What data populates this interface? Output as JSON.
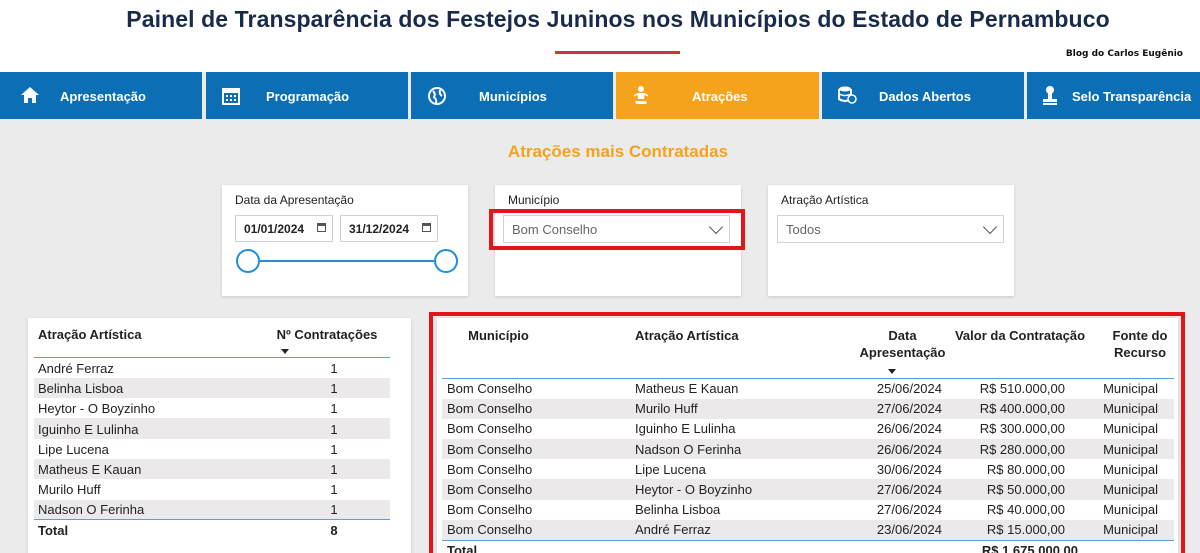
{
  "header": {
    "title": "Painel de Transparência dos Festejos Juninos nos Municípios do Estado de Pernambuco",
    "credit": "Blog do Carlos Eugênio"
  },
  "nav": {
    "tabs": [
      {
        "label": "Apresentação",
        "icon": "home-icon"
      },
      {
        "label": "Programação",
        "icon": "calendar-icon"
      },
      {
        "label": "Municípios",
        "icon": "globe-icon"
      },
      {
        "label": "Atrações",
        "icon": "performer-icon",
        "active": true
      },
      {
        "label": "Dados Abertos",
        "icon": "database-icon"
      },
      {
        "label": "Selo Transparência",
        "icon": "stamp-icon"
      }
    ]
  },
  "section_title": "Atrações mais Contratadas",
  "filters": {
    "date": {
      "label": "Data da Apresentação",
      "start": "01/01/2024",
      "end": "31/12/2024"
    },
    "municipio": {
      "label": "Município",
      "value": "Bom Conselho"
    },
    "atracao": {
      "label": "Atração Artística",
      "value": "Todos"
    }
  },
  "left_table": {
    "headers": [
      "Atração Artística",
      "Nº Contratações"
    ],
    "rows": [
      [
        "André Ferraz",
        "1"
      ],
      [
        "Belinha Lisboa",
        "1"
      ],
      [
        "Heytor - O Boyzinho",
        "1"
      ],
      [
        "Iguinho E Lulinha",
        "1"
      ],
      [
        "Lipe Lucena",
        "1"
      ],
      [
        "Matheus E Kauan",
        "1"
      ],
      [
        "Murilo Huff",
        "1"
      ],
      [
        "Nadson O Ferinha",
        "1"
      ]
    ],
    "total_label": "Total",
    "total_value": "8"
  },
  "right_table": {
    "headers": [
      "Município",
      "Atração Artística",
      "Data Apresentação",
      "Valor da Contratação",
      "Fonte do Recurso"
    ],
    "rows": [
      [
        "Bom Conselho",
        "Matheus E Kauan",
        "25/06/2024",
        "R$ 510.000,00",
        "Municipal"
      ],
      [
        "Bom Conselho",
        "Murilo Huff",
        "27/06/2024",
        "R$ 400.000,00",
        "Municipal"
      ],
      [
        "Bom Conselho",
        "Iguinho E Lulinha",
        "26/06/2024",
        "R$ 300.000,00",
        "Municipal"
      ],
      [
        "Bom Conselho",
        "Nadson O Ferinha",
        "26/06/2024",
        "R$ 280.000,00",
        "Municipal"
      ],
      [
        "Bom Conselho",
        "Lipe Lucena",
        "30/06/2024",
        "R$ 80.000,00",
        "Municipal"
      ],
      [
        "Bom Conselho",
        "Heytor - O Boyzinho",
        "27/06/2024",
        "R$ 50.000,00",
        "Municipal"
      ],
      [
        "Bom Conselho",
        "Belinha Lisboa",
        "27/06/2024",
        "R$ 40.000,00",
        "Municipal"
      ],
      [
        "Bom Conselho",
        "André Ferraz",
        "23/06/2024",
        "R$ 15.000,00",
        "Municipal"
      ]
    ],
    "total_label": "Total",
    "total_value": "R$ 1.675.000,00"
  },
  "colors": {
    "nav_blue": "#0c6fb5",
    "nav_active": "#f5a21c",
    "highlight_red": "#e5141b",
    "title_navy": "#1a2b4a"
  }
}
